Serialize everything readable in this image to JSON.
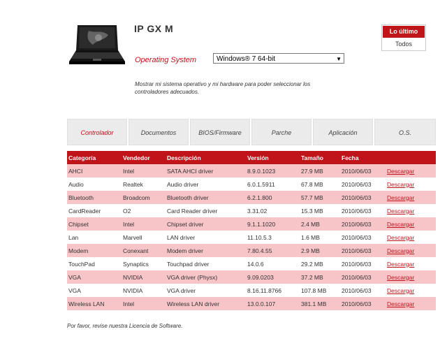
{
  "product": {
    "title": "IP GX M"
  },
  "os": {
    "label": "Operating System",
    "selected": "Windows® 7 64-bit"
  },
  "hint": "Mostrar mi sistema operativo y mi hardware para poder seleccionar los controladores adecuados.",
  "filter": {
    "latest": "Lo último",
    "all": "Todos"
  },
  "tabs": [
    "Controlador",
    "Documentos",
    "BIOS/Firmware",
    "Parche",
    "Aplicación",
    "O.S."
  ],
  "table": {
    "headers": [
      "Categoría",
      "Vendedor",
      "Descripción",
      "Versión",
      "Tamaño",
      "Fecha",
      ""
    ],
    "rows": [
      [
        "AHCI",
        "Intel",
        "SATA AHCI driver",
        "8.9.0.1023",
        "27.9 MB",
        "2010/06/03",
        "Descargar"
      ],
      [
        "Audio",
        "Realtek",
        "Audio driver",
        "6.0.1.5911",
        "67.8 MB",
        "2010/06/03",
        "Descargar"
      ],
      [
        "Bluetooth",
        "Broadcom",
        "Bluetooth driver",
        "6.2.1.800",
        "57.7 MB",
        "2010/06/03",
        "Descargar"
      ],
      [
        "CardReader",
        "O2",
        "Card Reader driver",
        "3.31.02",
        "15.3 MB",
        "2010/06/03",
        "Descargar"
      ],
      [
        "Chipset",
        "Intel",
        "Chipset driver",
        "9.1.1.1020",
        "2.4 MB",
        "2010/06/03",
        "Descargar"
      ],
      [
        "Lan",
        "Marvell",
        "LAN driver",
        "11.10.5.3",
        "1.6 MB",
        "2010/06/03",
        "Descargar"
      ],
      [
        "Modem",
        "Conexant",
        "Modem driver",
        "7.80.4.55",
        "2.9 MB",
        "2010/06/03",
        "Descargar"
      ],
      [
        "TouchPad",
        "Synaptics",
        "Touchpad driver",
        "14.0.6",
        "29.2 MB",
        "2010/06/03",
        "Descargar"
      ],
      [
        "VGA",
        "NVIDIA",
        "VGA driver (Physx)",
        "9.09.0203",
        "37.2 MB",
        "2010/06/03",
        "Descargar"
      ],
      [
        "VGA",
        "NVIDIA",
        "VGA driver",
        "8.16.11.8766",
        "107.8 MB",
        "2010/06/03",
        "Descargar"
      ],
      [
        "Wireless LAN",
        "Intel",
        "Wireless LAN driver",
        "13.0.0.107",
        "381.1 MB",
        "2010/06/03",
        "Descargar"
      ]
    ]
  },
  "footer": "Por favor, revise nuestra Licencia de Software.",
  "colors": {
    "accent": "#c0141b",
    "row_highlight": "#f7c4c8",
    "tab_bg": "#ebebeb"
  }
}
